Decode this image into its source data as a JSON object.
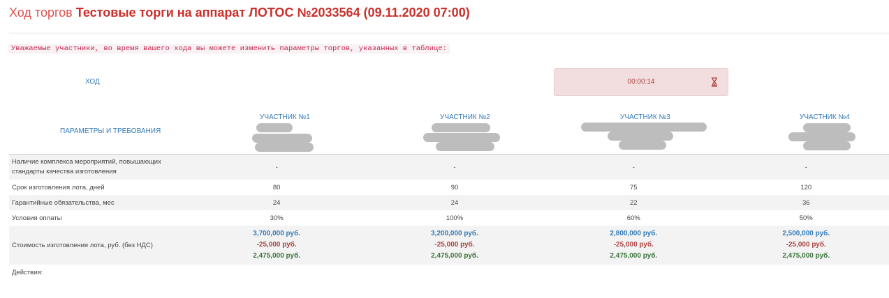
{
  "header": {
    "prefix": "Ход торгов",
    "title": "Тестовые торги на аппарат ЛОТОС №2033564 (09.11.2020 07:00)"
  },
  "notice": "Уважаемые участники, во время вашего хода вы можете изменить параметры торгов, указанных в таблице:",
  "turn": {
    "label": "ХОД",
    "timer": "00:00:14"
  },
  "params_header": "ПАРАМЕТРЫ И ТРЕБОВАНИЯ",
  "participants": [
    "УЧАСТНИК №1",
    "УЧАСТНИК №2",
    "УЧАСТНИК №3",
    "УЧАСТНИК №4"
  ],
  "rows": [
    {
      "label": "Наличие комплекса мероприятий, повышающих стандарты качества изготовления",
      "values": [
        "-",
        "-",
        "-",
        "-"
      ]
    },
    {
      "label": "Срок изготовления лота, дней",
      "values": [
        "80",
        "90",
        "75",
        "120"
      ]
    },
    {
      "label": "Гарантийные обязательства, мес",
      "values": [
        "24",
        "24",
        "22",
        "36"
      ]
    },
    {
      "label": "Условия оплаты",
      "values": [
        "30%",
        "100%",
        "60%",
        "50%"
      ]
    }
  ],
  "cost": {
    "label": "Стоимость изготовления лота, руб. (без НДС)",
    "items": [
      {
        "price": "3,700,000 руб.",
        "delta": "-25,000 руб.",
        "total": "2,475,000 руб."
      },
      {
        "price": "3,200,000 руб.",
        "delta": "-25,000 руб.",
        "total": "2,475,000 руб."
      },
      {
        "price": "2,800,000 руб.",
        "delta": "-25,000 руб.",
        "total": "2,475,000 руб."
      },
      {
        "price": "2,500,000 руб.",
        "delta": "-25,000 руб.",
        "total": "2,475,000 руб."
      }
    ]
  },
  "actions_label": "Действия:",
  "colors": {
    "title": "#c9302c",
    "notice": "#c7254e",
    "link": "#337ab7",
    "danger": "#a94442",
    "success": "#3c763d",
    "timer_bg": "#f2dede"
  },
  "icons": {
    "timer": "hourglass-icon"
  }
}
